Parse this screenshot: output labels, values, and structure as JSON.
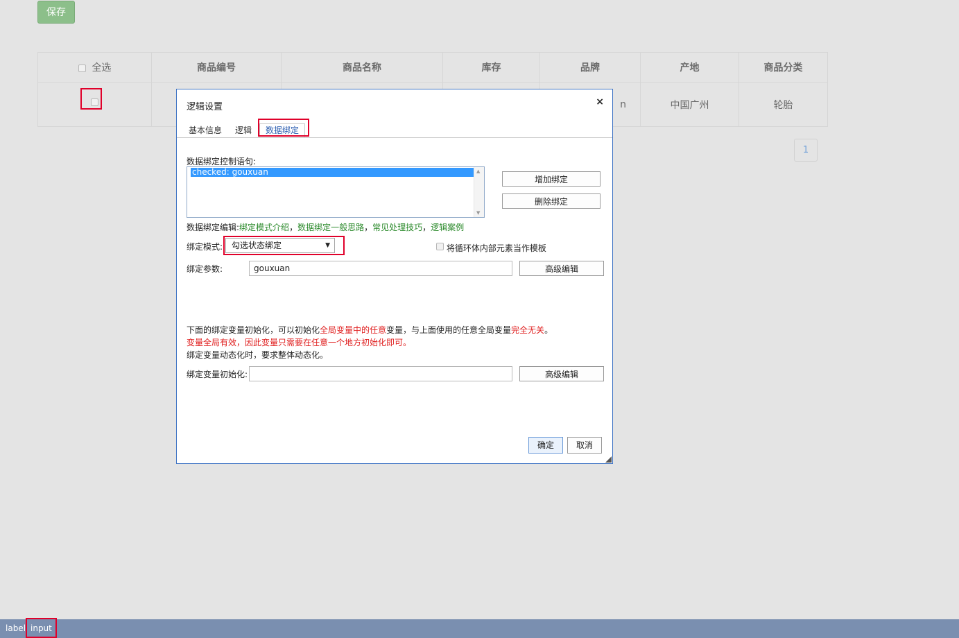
{
  "page": {
    "save_label": "保存"
  },
  "grid": {
    "select_all": "全选",
    "columns": [
      "商品编号",
      "商品名称",
      "库存",
      "品牌",
      "产地",
      "商品分类"
    ],
    "row": {
      "brand_partial": "n",
      "origin": "中国广州",
      "category": "轮胎"
    }
  },
  "pager": {
    "current": "1"
  },
  "dialog": {
    "title": "逻辑设置",
    "close": "×",
    "tabs": [
      "基本信息",
      "逻辑",
      "数据绑定"
    ],
    "statements_label": "数据绑定控制语句:",
    "statements": [
      "checked: gouxuan"
    ],
    "add_binding": "增加绑定",
    "delete_binding": "删除绑定",
    "edit_label": "数据绑定编辑:",
    "links": [
      "绑定模式介绍",
      "数据绑定一般思路",
      "常见处理技巧",
      "逻辑案例"
    ],
    "link_sep": "，",
    "mode_label": "绑定模式:",
    "mode_value": "勾选状态绑定",
    "loop_template_label": "将循环体内部元素当作模板",
    "param_label": "绑定参数:",
    "param_value": "gouxuan",
    "advanced_edit": "高级编辑",
    "note1": {
      "a": "下面的绑定变量初始化，可以初始化",
      "b": "全局变量中的任意",
      "c": "变量，与上面使用的任意全局变量",
      "d": "完全无关",
      "e": "。"
    },
    "note2": "变量全局有效，因此变量只需要在任意一个地方初始化即可。",
    "note3": "绑定变量动态化时，要求整体动态化。",
    "init_label": "绑定变量初始化:",
    "init_value": "",
    "ok": "确定",
    "cancel": "取消"
  },
  "bottom_bar": {
    "label": "label",
    "input": "input"
  },
  "colors": {
    "highlight": "#e0002a",
    "save_green": "#8cbf8a",
    "link_green": "#2b8a2b",
    "warn_red": "#e02020",
    "dialog_border": "#3f74c4",
    "bottom_bar": "#7a8fb0"
  }
}
